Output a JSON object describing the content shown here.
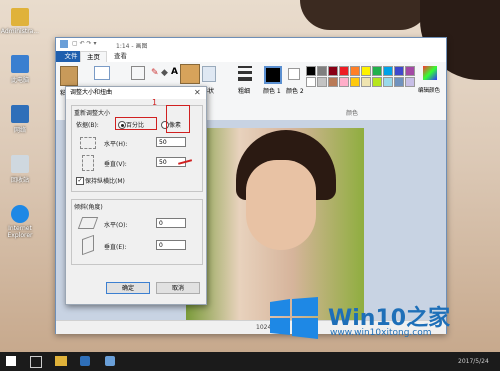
{
  "desktop": {
    "icons": [
      {
        "label": "Administra..."
      },
      {
        "label": "此电脑"
      },
      {
        "label": "网络"
      },
      {
        "label": "回收站"
      },
      {
        "label": "Internet Explorer"
      }
    ]
  },
  "paint": {
    "title": "1:14 - 画图",
    "tabs": {
      "file": "文件",
      "home": "主页",
      "view": "查看"
    },
    "ribbon": {
      "paste": "粘贴",
      "shapes": "形状",
      "size": "粗细",
      "color1": "颜色 1",
      "color2": "颜色 2",
      "colors_group": "颜色",
      "edit_colors": "编辑颜色",
      "tools_letter": "A"
    },
    "status": {
      "dimensions": "1024 × 7"
    },
    "palette": [
      "#000000",
      "#7f7f7f",
      "#880015",
      "#ed1c24",
      "#ff7f27",
      "#fff200",
      "#22b14c",
      "#00a2e8",
      "#3f48cc",
      "#a349a4",
      "#ffffff",
      "#c3c3c3",
      "#b97a57",
      "#ffaec9",
      "#ffc90e",
      "#efe4b0",
      "#b5e61d",
      "#99d9ea",
      "#7092be",
      "#c8bfe7"
    ]
  },
  "dialog": {
    "title": "调整大小和扭曲",
    "resize_heading": "重新调整大小",
    "by_label": "依据(B):",
    "percent": "百分比",
    "pixels": "像素",
    "horizontal": "水平(H):",
    "vertical": "垂直(V):",
    "h_value": "50",
    "v_value": "50",
    "keep_ratio": "保持纵横比(M)",
    "skew_heading": "倾斜(角度)",
    "skew_h": "水平(O):",
    "skew_v": "垂直(E):",
    "skew_h_value": "0",
    "skew_v_value": "0",
    "ok": "确定",
    "cancel": "取消",
    "step1": "1"
  },
  "watermark": {
    "brand_a": "Win10",
    "brand_b": "之家",
    "url": "www.win10xitong.com"
  },
  "taskbar": {
    "date": "2017/5/24"
  }
}
